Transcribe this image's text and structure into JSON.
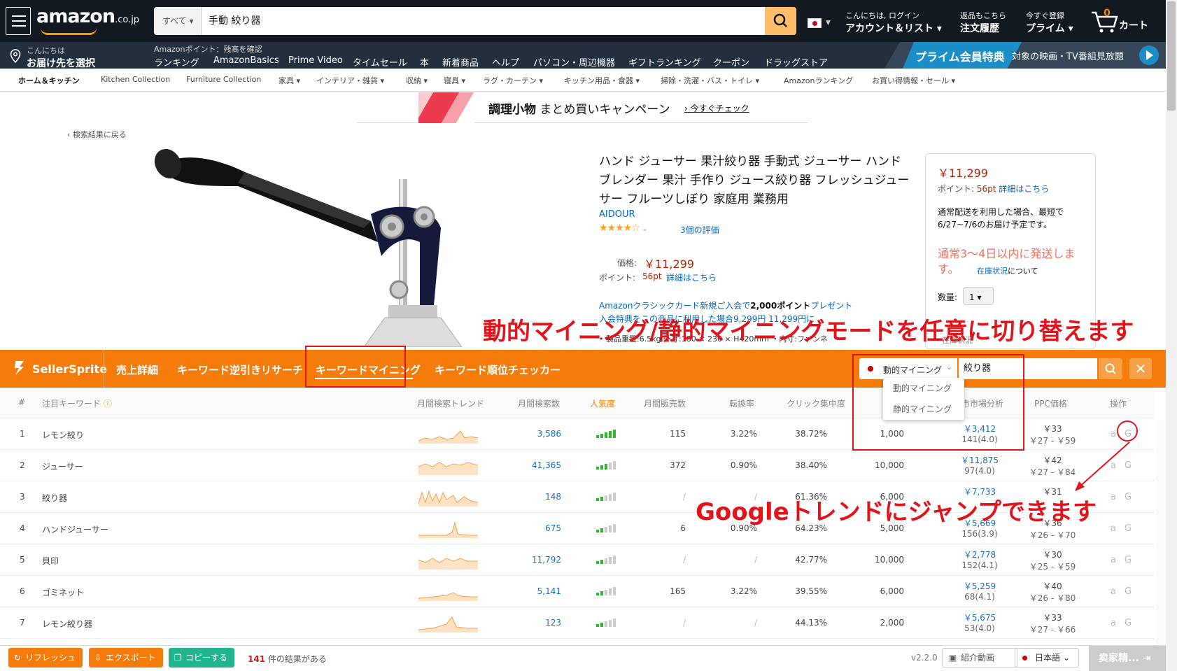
{
  "header": {
    "logo": "amazon",
    "logo_suffix": ".co.jp",
    "search_category": "すべて",
    "search_query": "手動 絞り器",
    "account_greeting": "こんにちは, ログイン",
    "account_label": "アカウント＆リスト",
    "orders_top": "返品もこちら",
    "orders_label": "注文履歴",
    "prime_top": "今すぐ登録",
    "prime_label": "プライム",
    "cart_count": "0",
    "cart_label": "カート"
  },
  "nav": {
    "deliver_top": "こんにちは",
    "deliver_label": "お届け先を選択",
    "points_note": "Amazonポイント：残高を確認",
    "links": [
      "ランキング",
      "AmazonBasics",
      "Prime Video",
      "タイムセール",
      "本",
      "新着商品",
      "ヘルプ",
      "パソコン・周辺機器",
      "ギフトランキング",
      "クーポン",
      "ドラッグストア"
    ],
    "prime_banner": "プライム会員特典",
    "prime_sub": "対象の映画・TV番組見放題"
  },
  "subnav": [
    "ホーム＆キッチン",
    "Kitchen Collection",
    "Furniture Collection",
    "家具",
    "インテリア・雑貨",
    "収納",
    "寝具",
    "ラグ・カーテン",
    "キッチン用品・食器",
    "掃除・洗濯・バス・トイレ",
    "Amazonランキング",
    "お買い得情報・セール"
  ],
  "campaign": {
    "bold": "調理小物",
    "rest": "まとめ買いキャンペーン",
    "link": "今すぐチェック"
  },
  "back_link": "‹ 検索結果に戻る",
  "product": {
    "title": "ハンド ジューサー 果汁絞り器 手動式 ジューサー ハンドブレンダー 果汁 手作り ジュース絞り器 フレッシュジューサー フルーツしぼり 家庭用 業務用",
    "brand": "AIDOUR",
    "stars": "★★★★☆",
    "reviews": "3個の評価",
    "price_label": "価格:",
    "price": "￥11,299",
    "points_label": "ポイント:",
    "points": "56pt",
    "points_link": "詳細はこちら",
    "card_promo": "Amazonクラシックカード新規ご入会で",
    "card_bold": "2,000ポイント",
    "card_tail": "プレゼント",
    "card_line2": "入会特典をこの商品に利用した場合9,299円 11,299円に",
    "spec": "• 製品重量:6.5kg 外寸:180 × 230 × H420mm ・内寸:ファンネ"
  },
  "buybox": {
    "price": "￥11,299",
    "points_label": "ポイント:",
    "points": "56pt",
    "points_link": "詳細はこちら",
    "delivery": "通常配送を利用した場合、最短で 6/27~7/6のお届け予定です。",
    "ships": "通常3～4日以内に発送します。",
    "stock_link": "在庫状況",
    "stock_tail": "について",
    "qty_label": "数量:",
    "qty": "1",
    "stock2": "在庫状況"
  },
  "annotations": {
    "mode": "動的マイニング/静的マイニングモードを任意に切り替えます",
    "google": "Googleトレンドにジャンプできます"
  },
  "sellersprite": {
    "brand": "SellerSprite",
    "tabs": [
      "売上詳細",
      "キーワード逆引きリサーチ",
      "キーワードマイニング",
      "キーワード順位チェッカー"
    ],
    "mode_selected": "動的マイニング",
    "keyword": "絞り器",
    "dropdown": [
      "動的マイニング",
      "静的マイニング"
    ],
    "headers": [
      "#",
      "注目キーワード",
      "月間検索トレンド",
      "月間検索数",
      "人気度",
      "月間販売数",
      "転換率",
      "クリック集中度",
      "",
      "市場分析",
      "PPC価格",
      "操作"
    ],
    "rows": [
      {
        "n": "1",
        "kw": "レモン絞り",
        "search": "3,586",
        "sales": "115",
        "cvr": "3.22%",
        "click": "38.72%",
        "prod": "1,000",
        "mkt": "￥3,412",
        "mkt2": "141(4.0)",
        "ppc": "￥33",
        "ppc2": "￥27 - ￥59",
        "pop": 5
      },
      {
        "n": "2",
        "kw": "ジューサー",
        "search": "41,365",
        "sales": "372",
        "cvr": "0.90%",
        "click": "38.40%",
        "prod": "10,000",
        "mkt": "￥11,875",
        "mkt2": "97(4.0)",
        "ppc": "￥42",
        "ppc2": "￥27 - ￥84",
        "pop": 3
      },
      {
        "n": "3",
        "kw": "絞り器",
        "search": "148",
        "sales": "/",
        "cvr": "/",
        "click": "61.36%",
        "prod": "6,000",
        "mkt": "￥7,733",
        "mkt2": "",
        "ppc": "￥31",
        "ppc2": "",
        "pop": 2
      },
      {
        "n": "4",
        "kw": "ハンドジューサー",
        "search": "675",
        "sales": "6",
        "cvr": "0.90%",
        "click": "64.23%",
        "prod": "5,000",
        "mkt": "￥5,669",
        "mkt2": "156(3.9)",
        "ppc": "￥36",
        "ppc2": "￥26 - ￥70",
        "pop": 2
      },
      {
        "n": "5",
        "kw": "貝印",
        "search": "11,792",
        "sales": "/",
        "cvr": "/",
        "click": "42.77%",
        "prod": "10,000",
        "mkt": "￥2,778",
        "mkt2": "152(4.1)",
        "ppc": "￥30",
        "ppc2": "￥25 - ￥59",
        "pop": 2
      },
      {
        "n": "6",
        "kw": "ゴミネット",
        "search": "5,141",
        "sales": "165",
        "cvr": "3.22%",
        "click": "39.55%",
        "prod": "6,000",
        "mkt": "￥5,259",
        "mkt2": "68(4.1)",
        "ppc": "￥40",
        "ppc2": "￥26 - ￥80",
        "pop": 2
      },
      {
        "n": "7",
        "kw": "レモン絞り器",
        "search": "123",
        "sales": "/",
        "cvr": "/",
        "click": "44.13%",
        "prod": "2,000",
        "mkt": "￥5,675",
        "mkt2": "53(4.0)",
        "ppc": "￥33",
        "ppc2": "￥27 - ￥66",
        "pop": 2
      }
    ]
  },
  "footer": {
    "refresh": "リフレッシュ",
    "export": "エクスポート",
    "copy": "コピーする",
    "count": "141",
    "count_tail": "件の結果がある",
    "version": "v2.2.0",
    "video": "紹介動画",
    "lang": "日本語",
    "seller": "卖家精..."
  },
  "colors": {
    "amazon_dark": "#131921",
    "amazon_nav": "#232f3e",
    "sprite_orange": "#f57c0a",
    "annotation_red": "#e0141a",
    "link_blue": "#0066c0"
  }
}
